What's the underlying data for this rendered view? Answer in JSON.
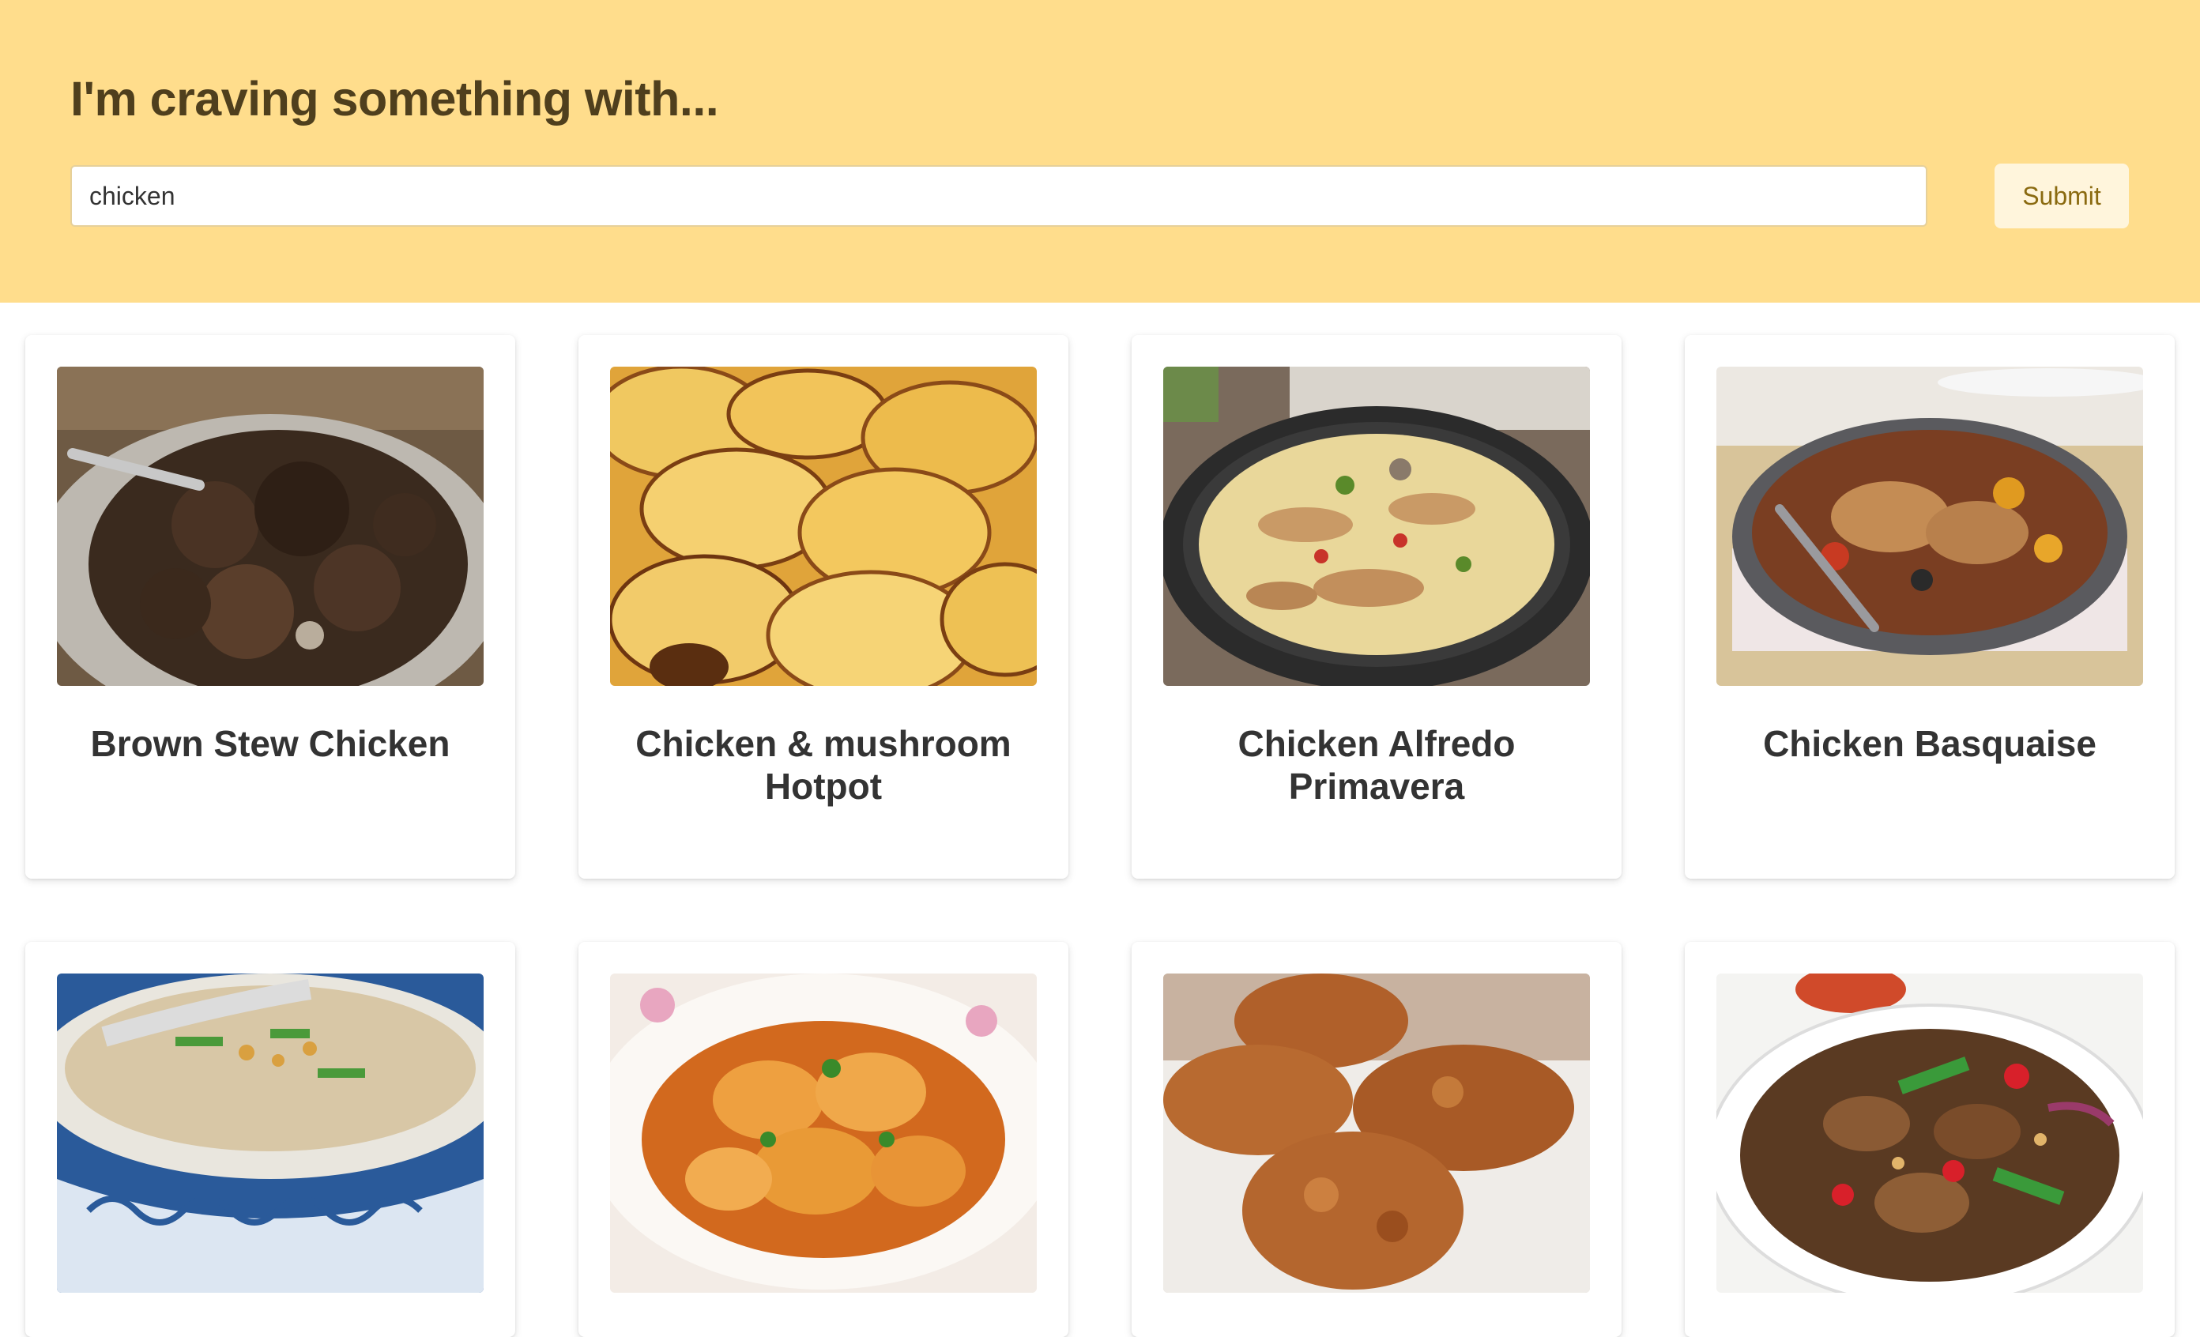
{
  "header": {
    "title": "I'm craving something with...",
    "search_value": "chicken",
    "submit_label": "Submit"
  },
  "recipes": [
    {
      "title": "Brown Stew Chicken"
    },
    {
      "title": "Chicken & mushroom Hotpot"
    },
    {
      "title": "Chicken Alfredo Primavera"
    },
    {
      "title": "Chicken Basquaise"
    },
    {
      "title": ""
    },
    {
      "title": ""
    },
    {
      "title": ""
    },
    {
      "title": ""
    }
  ],
  "colors": {
    "header_bg": "#ffdd8c",
    "title_text": "#4f3f1d",
    "button_bg": "#fff5dc",
    "button_text": "#8a6a10"
  }
}
